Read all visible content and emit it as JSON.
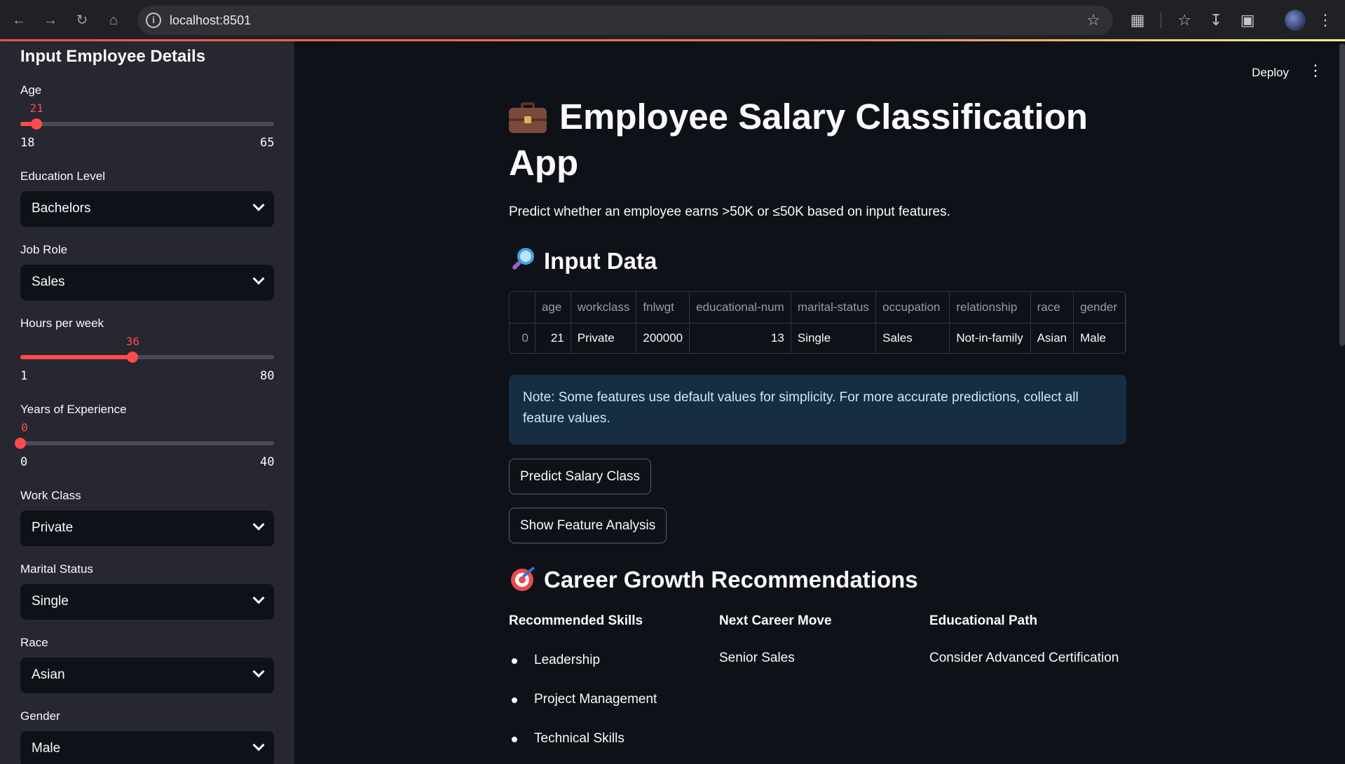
{
  "browser": {
    "url": "localhost:8501"
  },
  "sidebar": {
    "title": "Input Employee Details",
    "age": {
      "label": "Age",
      "value": "21",
      "min": "18",
      "max": "65",
      "fraction": 0.064
    },
    "education": {
      "label": "Education Level",
      "value": "Bachelors"
    },
    "job_role": {
      "label": "Job Role",
      "value": "Sales"
    },
    "hours": {
      "label": "Hours per week",
      "value": "36",
      "min": "1",
      "max": "80",
      "fraction": 0.443
    },
    "experience": {
      "label": "Years of Experience",
      "value": "0",
      "min": "0",
      "max": "40",
      "fraction": 0.0
    },
    "work_class": {
      "label": "Work Class",
      "value": "Private"
    },
    "marital": {
      "label": "Marital Status",
      "value": "Single"
    },
    "race": {
      "label": "Race",
      "value": "Asian"
    },
    "gender": {
      "label": "Gender",
      "value": "Male"
    }
  },
  "header": {
    "deploy_label": "Deploy"
  },
  "main": {
    "title": "Employee Salary Classification App",
    "subtitle": "Predict whether an employee earns >50K or ≤50K based on input features.",
    "input_heading": "Input Data",
    "table": {
      "columns": [
        "",
        "age",
        "workclass",
        "fnlwgt",
        "educational-num",
        "marital-status",
        "occupation",
        "relationship",
        "race",
        "gender"
      ],
      "row": [
        "0",
        "21",
        "Private",
        "200000",
        "13",
        "Single",
        "Sales",
        "Not-in-family",
        "Asian",
        "Male"
      ]
    },
    "note": "Note: Some features use default values for simplicity. For more accurate predictions, collect all feature values.",
    "predict_button": "Predict Salary Class",
    "analysis_button": "Show Feature Analysis",
    "career_heading": "Career Growth Recommendations",
    "skills": {
      "heading": "Recommended Skills",
      "items": [
        "Leadership",
        "Project Management",
        "Technical Skills"
      ]
    },
    "next_move": {
      "heading": "Next Career Move",
      "value": "Senior Sales"
    },
    "education_path": {
      "heading": "Educational Path",
      "value": "Consider Advanced Certification"
    }
  },
  "colors": {
    "accent": "#ff4b4b",
    "background": "#0e1117",
    "sidebar": "#262730",
    "info_bg": "#172d43",
    "info_text": "#c7ebff"
  }
}
